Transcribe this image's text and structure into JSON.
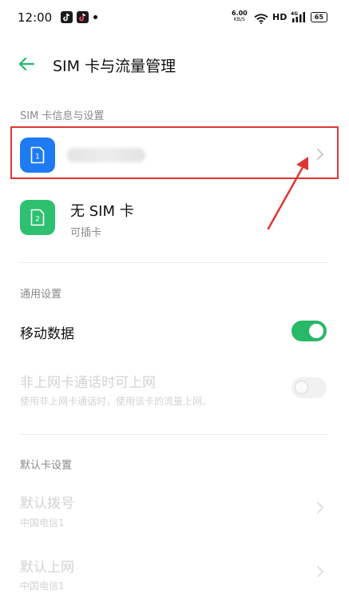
{
  "status_bar": {
    "time": "12:00",
    "net_speed_value": "6.00",
    "net_speed_unit": "KB/S",
    "hd": "HD",
    "signal_label": "4G",
    "battery": "65"
  },
  "header": {
    "title": "SIM 卡与流量管理"
  },
  "sim_section": {
    "title": "SIM 卡信息与设置",
    "sim1": {
      "slot": "1",
      "name_obscured": true
    },
    "sim2": {
      "slot": "2",
      "name": "无 SIM 卡",
      "subtitle": "可插卡"
    }
  },
  "general_section": {
    "title": "通用设置",
    "mobile_data": {
      "label": "移动数据",
      "enabled": true
    },
    "non_data_card": {
      "label": "非上网卡通话时可上网",
      "subtitle": "使用非上网卡通话时，使用该卡的流量上网。",
      "enabled": false
    }
  },
  "default_section": {
    "title": "默认卡设置",
    "default_dial": {
      "label": "默认拨号",
      "value": "中国电信1"
    },
    "default_internet": {
      "label": "默认上网",
      "value": "中国电信1"
    }
  },
  "colors": {
    "accent_green": "#27b868",
    "sim1_blue": "#1f7bf2",
    "sim2_green": "#2cc06f",
    "annotation_red": "#e03535"
  }
}
